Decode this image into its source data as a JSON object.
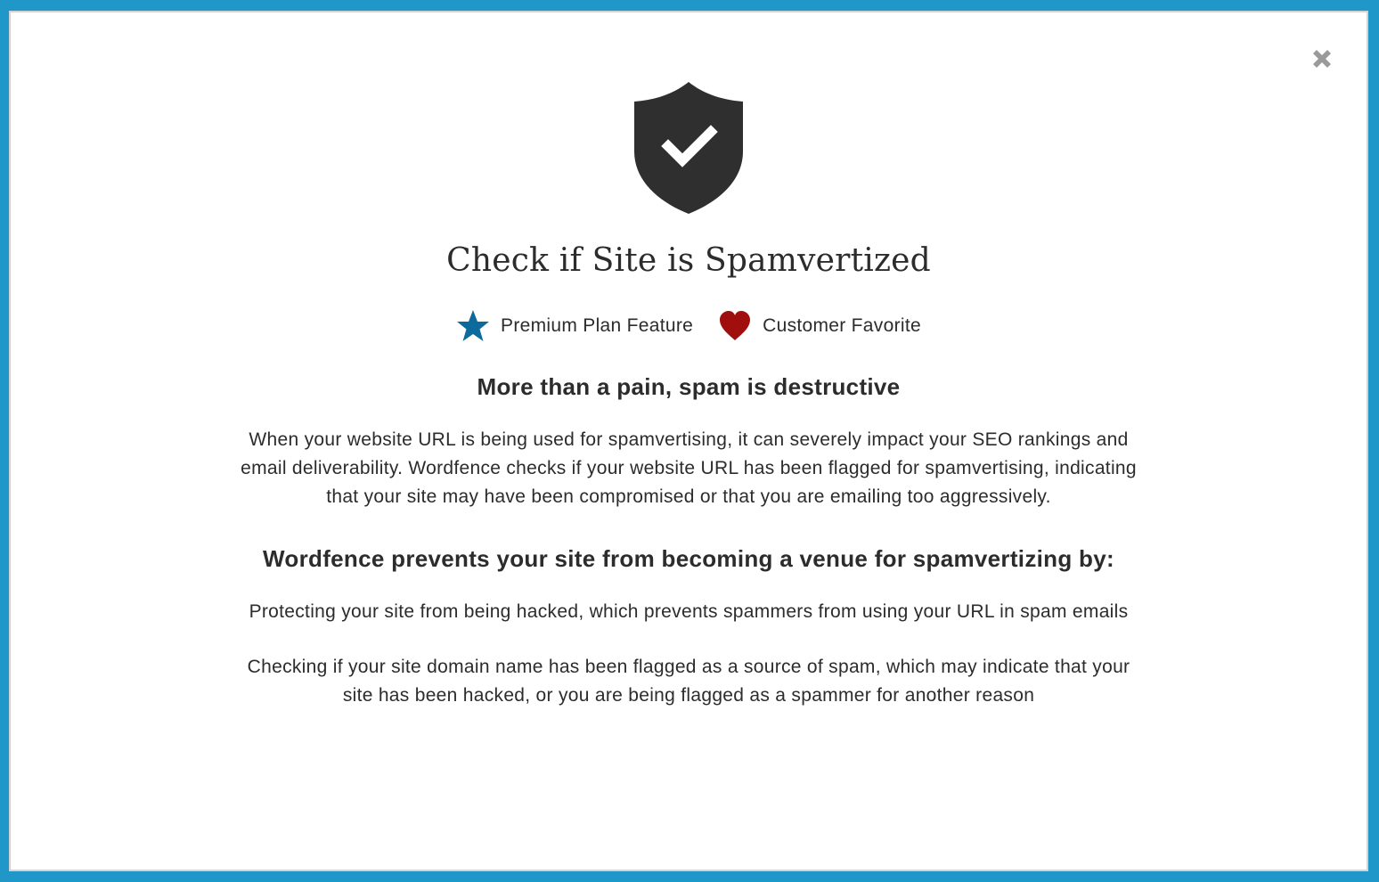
{
  "dialog": {
    "title": "Check if Site is Spamvertized",
    "close_icon": "close-icon",
    "shield_icon": "shield-check-icon",
    "badges": [
      {
        "label": "Premium Plan Feature",
        "icon": "star-icon",
        "color": "#0c6b9c"
      },
      {
        "label": "Customer Favorite",
        "icon": "heart-icon",
        "color": "#a10e0e"
      }
    ],
    "section1": {
      "heading": "More than a pain, spam is destructive",
      "body": "When your website URL is being used for spamvertising, it can severely impact your SEO rankings and email deliverability. Wordfence checks if your website URL has been flagged for spamvertising, indicating that your site may have been compromised or that you are emailing too aggressively."
    },
    "section2": {
      "heading": "Wordfence prevents your site from becoming a venue for spamvertizing by:",
      "items": [
        "Protecting your site from being hacked, which prevents spammers from using your URL in spam emails",
        "Checking if your site domain name has been flagged as a source of spam, which may indicate that your site has been hacked, or you are being flagged as a spammer for another reason"
      ]
    }
  },
  "colors": {
    "frame_border": "#1f97c9",
    "shield": "#2f2f2f",
    "close": "#9a9a9a"
  }
}
